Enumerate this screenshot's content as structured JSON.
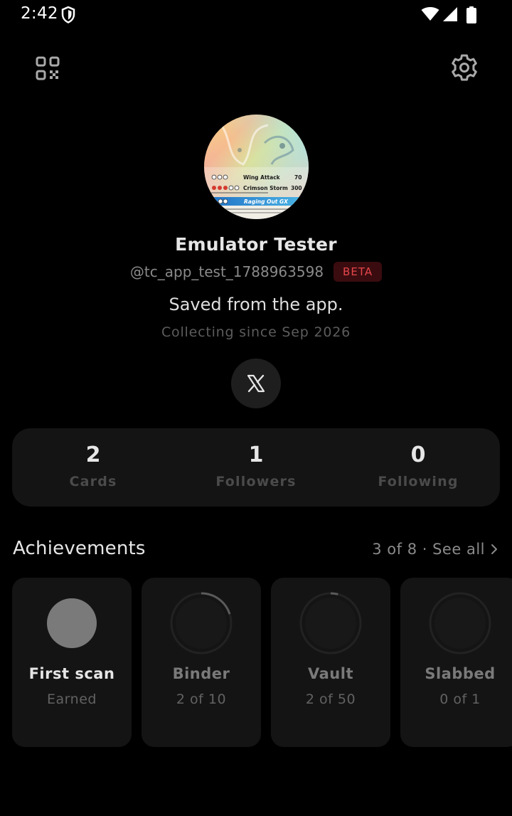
{
  "status_bar": {
    "time": "2:42"
  },
  "profile": {
    "avatar_card": {
      "attack_1": "Wing Attack",
      "damage_1": "70",
      "attack_2": "Crimson Storm",
      "damage_2": "300",
      "banner": "Raging Out GX"
    },
    "name": "Emulator Tester",
    "handle": "@tc_app_test_1788963598",
    "badge": "BETA",
    "bio": "Saved from the app.",
    "since": "Collecting since Sep 2026",
    "social_icon": "x-logo-icon"
  },
  "stats": [
    {
      "value": "2",
      "label": "Cards"
    },
    {
      "value": "1",
      "label": "Followers"
    },
    {
      "value": "0",
      "label": "Following"
    }
  ],
  "achievements": {
    "title": "Achievements",
    "summary": "3 of 8 · See all",
    "items": [
      {
        "name": "First scan",
        "status": "Earned",
        "progress": 1.0
      },
      {
        "name": "Binder",
        "status": "2 of 10",
        "progress": 0.2
      },
      {
        "name": "Vault",
        "status": "2 of 50",
        "progress": 0.04
      },
      {
        "name": "Slabbed",
        "status": "0 of 1",
        "progress": 0.0
      }
    ]
  },
  "colors": {
    "background": "#000000",
    "card": "#141414",
    "beta_text": "#e5464b",
    "beta_bg": "#3a0c0f"
  }
}
